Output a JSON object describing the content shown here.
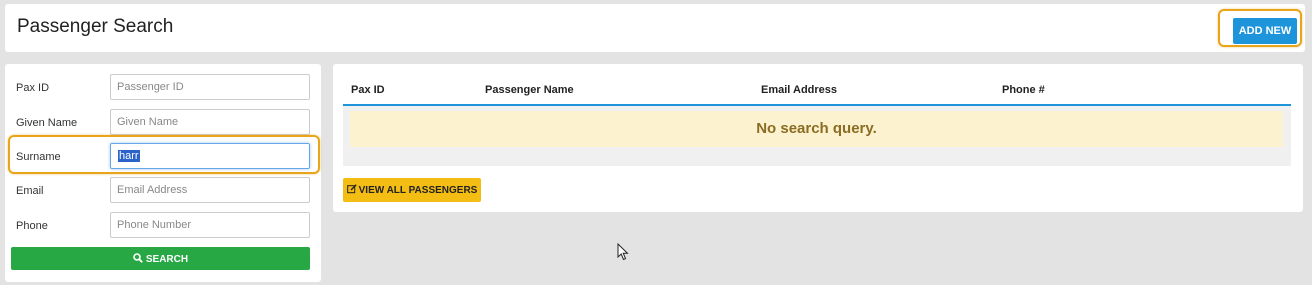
{
  "header": {
    "title": "Passenger Search",
    "add_new_label": "ADD NEW"
  },
  "form": {
    "pax_id": {
      "label": "Pax ID",
      "placeholder": "Passenger ID",
      "value": ""
    },
    "given_name": {
      "label": "Given Name",
      "placeholder": "Given Name",
      "value": ""
    },
    "surname": {
      "label": "Surname",
      "placeholder": "",
      "value": "harr"
    },
    "email": {
      "label": "Email",
      "placeholder": "Email Address",
      "value": ""
    },
    "phone": {
      "label": "Phone",
      "placeholder": "Phone Number",
      "value": ""
    },
    "search_label": "SEARCH",
    "search_icon": "search-icon"
  },
  "results": {
    "columns": [
      "Pax ID",
      "Passenger Name",
      "Email Address",
      "Phone #"
    ],
    "empty_message": "No search query.",
    "view_all_label": "VIEW ALL PASSENGERS",
    "view_all_icon": "edit-icon"
  },
  "colors": {
    "primary": "#1e95db",
    "success": "#28a745",
    "warning": "#f4bd14",
    "highlight": "#e8a51c",
    "empty_bg": "#fcf2cf"
  }
}
